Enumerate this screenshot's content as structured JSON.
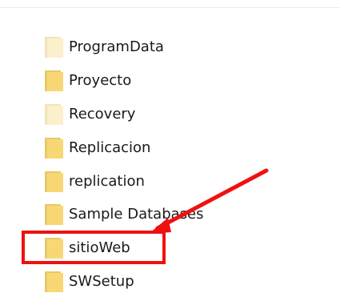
{
  "folders": [
    {
      "name": "ProgramData",
      "faded": true
    },
    {
      "name": "Proyecto",
      "faded": false
    },
    {
      "name": "Recovery",
      "faded": true
    },
    {
      "name": "Replicacion",
      "faded": false
    },
    {
      "name": "replication",
      "faded": false
    },
    {
      "name": "Sample Databases",
      "faded": false
    },
    {
      "name": "sitioWeb",
      "faded": false
    },
    {
      "name": "SWSetup",
      "faded": false
    }
  ],
  "annotation": {
    "highlighted_folder": "sitioWeb",
    "color": "#ef1111"
  },
  "icons": {
    "folder": "folder-icon"
  }
}
